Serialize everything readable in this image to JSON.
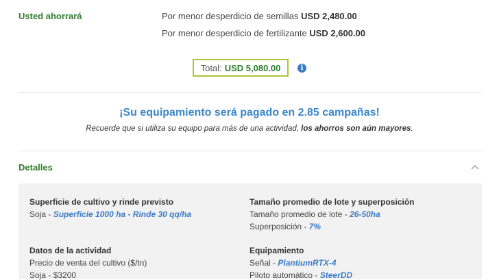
{
  "savings": {
    "label": "Usted ahorrará",
    "lines": [
      {
        "text": "Por menor desperdicio de semillas",
        "amount": "USD 2,480.00"
      },
      {
        "text": "Por menor desperdicio de fertilizante",
        "amount": "USD 2,600.00"
      }
    ],
    "total_label": "Total:",
    "total_value": "USD 5,080.00"
  },
  "payback": {
    "title": "¡Su equipamiento será pagado en 2.85 campañas!",
    "note_prefix": "Recuerde que si utiliza su equipo para más de una actividad,",
    "note_bold": "los ahorros son aún mayores",
    "note_suffix": "."
  },
  "details": {
    "header": "Detalles",
    "sections": {
      "cultivo": {
        "title": "Superficie de cultivo y rinde previsto",
        "crop": "Soja -",
        "surface": "Superficie 1000 ha",
        "sep": "-",
        "yield": "Rinde 30 qq/ha"
      },
      "lote": {
        "title": "Tamaño promedio de lote y superposición",
        "size_label": "Tamaño promedio de lote -",
        "size_value": "26-50ha",
        "overlap_label": "Superposición -",
        "overlap_value": "7%"
      },
      "actividad": {
        "title": "Datos de la actividad",
        "price_label": "Precio de venta del cultivo ($/tn)",
        "price_value": "Soja - $3200"
      },
      "equipo": {
        "title": "Equipamiento",
        "signal_label": "Señal -",
        "signal_value": "PlantiumRTX-4",
        "pilot_label": "Piloto automático -",
        "pilot_value": "SteerDD"
      }
    }
  },
  "colors": {
    "green": "#2e7d2e",
    "blue": "#3a7bc8",
    "accent_border": "#a6c834"
  }
}
